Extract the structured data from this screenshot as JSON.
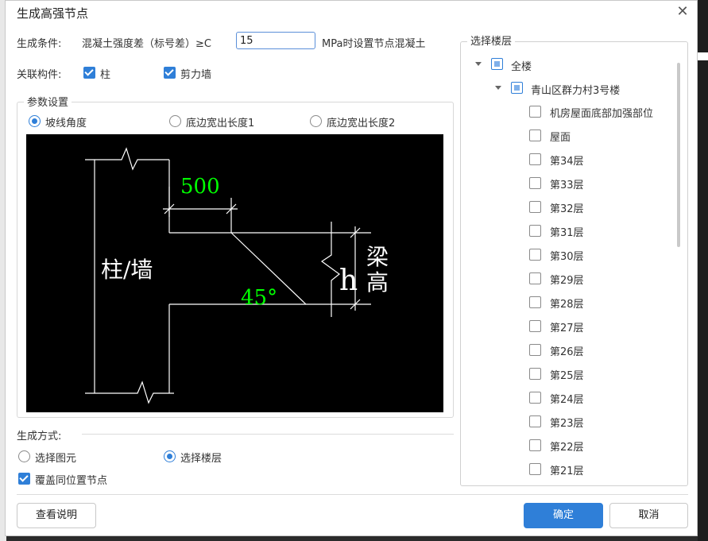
{
  "dialog": {
    "title": "生成高强节点"
  },
  "condition": {
    "label": "生成条件:",
    "text": "混凝土强度差（标号差）≥C",
    "value": "15",
    "suffix": "MPa时设置节点混凝土"
  },
  "related": {
    "label": "关联构件:",
    "items": [
      {
        "label": "柱",
        "checked": true
      },
      {
        "label": "剪力墙",
        "checked": true
      }
    ]
  },
  "params": {
    "title": "参数设置",
    "options": [
      {
        "label": "坡线角度",
        "selected": true
      },
      {
        "label": "底边宽出长度1",
        "selected": false
      },
      {
        "label": "底边宽出长度2",
        "selected": false
      }
    ]
  },
  "diagram": {
    "column_label": "柱/墙",
    "dimension": "500",
    "angle": "45°",
    "h_label": "h",
    "beam_label_1": "梁",
    "beam_label_2": "高",
    "colors": {
      "green": "#00ff00",
      "white": "#ffffff",
      "background": "#000000"
    }
  },
  "method": {
    "label": "生成方式:",
    "options": [
      {
        "label": "选择图元",
        "selected": false
      },
      {
        "label": "选择楼层",
        "selected": true
      }
    ],
    "overwrite": {
      "label": "覆盖同位置节点",
      "checked": true
    }
  },
  "floors": {
    "title": "选择楼层",
    "root": "全楼",
    "building": "青山区群力村3号楼",
    "items": [
      "机房屋面底部加强部位",
      "屋面",
      "第34层",
      "第33层",
      "第32层",
      "第31层",
      "第30层",
      "第29层",
      "第28层",
      "第27层",
      "第26层",
      "第25层",
      "第24层",
      "第23层",
      "第22层",
      "第21层"
    ]
  },
  "buttons": {
    "help": "查看说明",
    "ok": "确定",
    "cancel": "取消"
  },
  "accent": "#2f7fd8"
}
